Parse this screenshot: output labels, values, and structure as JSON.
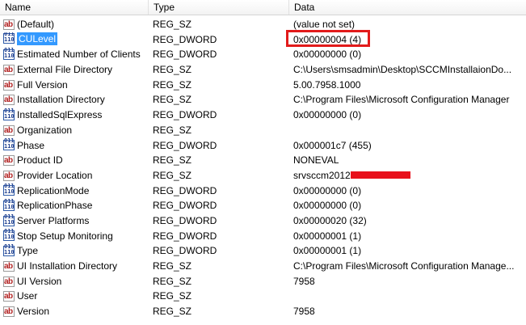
{
  "columns": {
    "name": "Name",
    "type": "Type",
    "data": "Data"
  },
  "rows": [
    {
      "icon": "string-value-icon",
      "kind": "sz",
      "name": "(Default)",
      "type": "REG_SZ",
      "data": "(value not set)"
    },
    {
      "icon": "dword-value-icon",
      "kind": "dword",
      "name": "CULevel",
      "type": "REG_DWORD",
      "data": "0x00000004 (4)",
      "selected": true
    },
    {
      "icon": "dword-value-icon",
      "kind": "dword",
      "name": "Estimated Number of Clients",
      "type": "REG_DWORD",
      "data": "0x00000000 (0)"
    },
    {
      "icon": "string-value-icon",
      "kind": "sz",
      "name": "External File Directory",
      "type": "REG_SZ",
      "data": "C:\\Users\\smsadmin\\Desktop\\SCCMInstallaionDo..."
    },
    {
      "icon": "string-value-icon",
      "kind": "sz",
      "name": "Full Version",
      "type": "REG_SZ",
      "data": "5.00.7958.1000"
    },
    {
      "icon": "string-value-icon",
      "kind": "sz",
      "name": "Installation Directory",
      "type": "REG_SZ",
      "data": "C:\\Program Files\\Microsoft Configuration Manager"
    },
    {
      "icon": "dword-value-icon",
      "kind": "dword",
      "name": "InstalledSqlExpress",
      "type": "REG_DWORD",
      "data": "0x00000000 (0)"
    },
    {
      "icon": "string-value-icon",
      "kind": "sz",
      "name": "Organization",
      "type": "REG_SZ",
      "data": ""
    },
    {
      "icon": "dword-value-icon",
      "kind": "dword",
      "name": "Phase",
      "type": "REG_DWORD",
      "data": "0x000001c7 (455)"
    },
    {
      "icon": "string-value-icon",
      "kind": "sz",
      "name": "Product ID",
      "type": "REG_SZ",
      "data": "NONEVAL"
    },
    {
      "icon": "string-value-icon",
      "kind": "sz",
      "name": "Provider Location",
      "type": "REG_SZ",
      "data": "srvsccm2012",
      "redacted": true
    },
    {
      "icon": "dword-value-icon",
      "kind": "dword",
      "name": "ReplicationMode",
      "type": "REG_DWORD",
      "data": "0x00000000 (0)"
    },
    {
      "icon": "dword-value-icon",
      "kind": "dword",
      "name": "ReplicationPhase",
      "type": "REG_DWORD",
      "data": "0x00000000 (0)"
    },
    {
      "icon": "dword-value-icon",
      "kind": "dword",
      "name": "Server Platforms",
      "type": "REG_DWORD",
      "data": "0x00000020 (32)"
    },
    {
      "icon": "dword-value-icon",
      "kind": "dword",
      "name": "Stop Setup Monitoring",
      "type": "REG_DWORD",
      "data": "0x00000001 (1)"
    },
    {
      "icon": "dword-value-icon",
      "kind": "dword",
      "name": "Type",
      "type": "REG_DWORD",
      "data": "0x00000001 (1)"
    },
    {
      "icon": "string-value-icon",
      "kind": "sz",
      "name": "UI Installation Directory",
      "type": "REG_SZ",
      "data": "C:\\Program Files\\Microsoft Configuration Manage..."
    },
    {
      "icon": "string-value-icon",
      "kind": "sz",
      "name": "UI Version",
      "type": "REG_SZ",
      "data": "7958"
    },
    {
      "icon": "string-value-icon",
      "kind": "sz",
      "name": "User",
      "type": "REG_SZ",
      "data": ""
    },
    {
      "icon": "string-value-icon",
      "kind": "sz",
      "name": "Version",
      "type": "REG_SZ",
      "data": "7958"
    }
  ],
  "colors": {
    "highlight_border": "#e21b1b",
    "selection": "#3399ff",
    "redaction": "#e8101b"
  }
}
